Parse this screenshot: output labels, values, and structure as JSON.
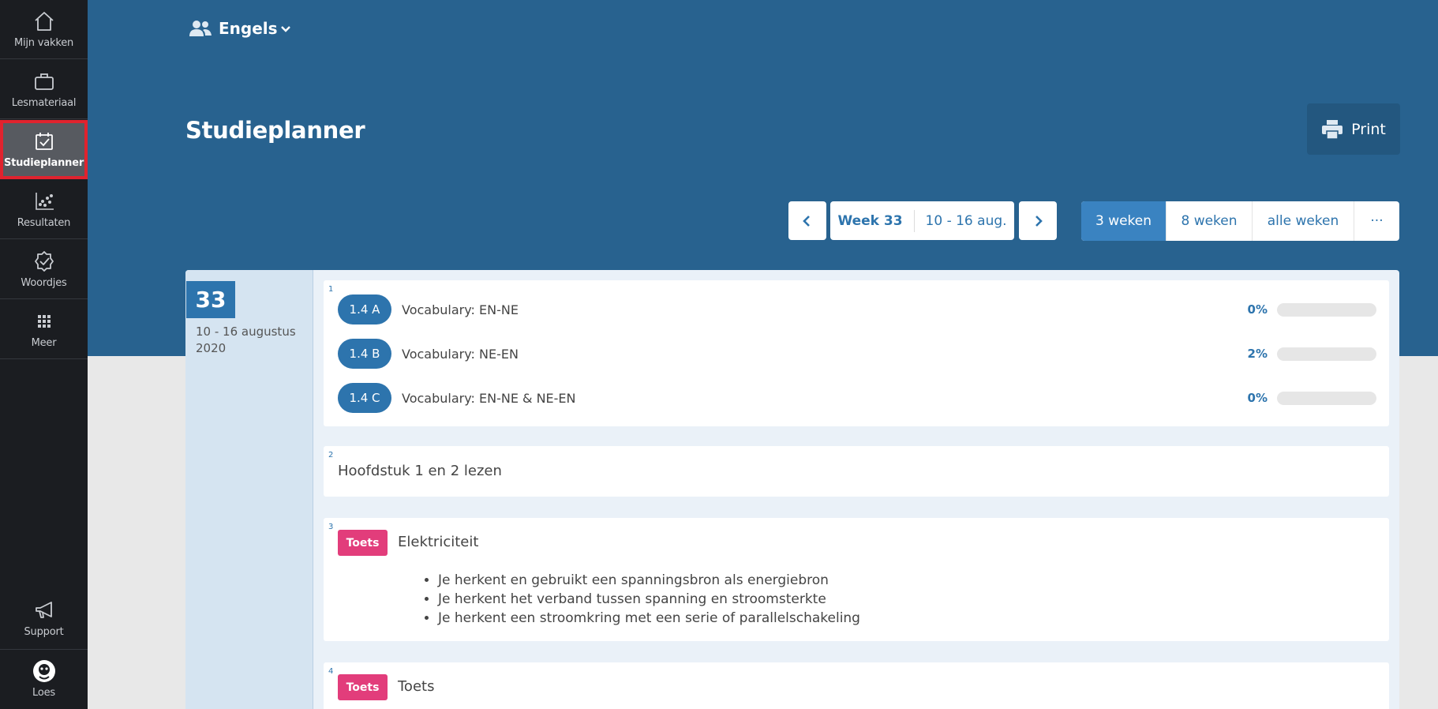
{
  "sidebar": {
    "items": [
      {
        "label": "Mijn vakken",
        "icon": "home-icon"
      },
      {
        "label": "Lesmateriaal",
        "icon": "briefcase-icon"
      },
      {
        "label": "Studieplanner",
        "icon": "calendar-check-icon",
        "active": true
      },
      {
        "label": "Resultaten",
        "icon": "chart-icon"
      },
      {
        "label": "Woordjes",
        "icon": "badge-check-icon"
      },
      {
        "label": "Meer",
        "icon": "grid-icon"
      }
    ],
    "support": {
      "label": "Support",
      "icon": "megaphone-icon"
    },
    "user": {
      "label": "Loes",
      "icon": "avatar-icon"
    }
  },
  "header": {
    "course": "Engels",
    "title": "Studieplanner",
    "print_label": "Print"
  },
  "week_nav": {
    "week": "Week 33",
    "range": "10 - 16 aug."
  },
  "range_options": [
    "3 weken",
    "8 weken",
    "alle weken",
    "···"
  ],
  "planner": {
    "week_number": "33",
    "week_dates": "10 - 16 augustus 2020",
    "cards": [
      {
        "num": "1",
        "rows": [
          {
            "code": "1.4 A",
            "title": "Vocabulary: EN-NE",
            "progress_label": "0%",
            "progress": 0
          },
          {
            "code": "1.4 B",
            "title": "Vocabulary: NE-EN",
            "progress_label": "2%",
            "progress": 2
          },
          {
            "code": "1.4 C",
            "title": "Vocabulary: EN-NE & NE-EN",
            "progress_label": "0%",
            "progress": 0
          }
        ]
      },
      {
        "num": "2",
        "text": "Hoofdstuk 1 en 2 lezen"
      },
      {
        "num": "3",
        "tag": "Toets",
        "title": "Elektriciteit",
        "bullets": [
          "Je herkent en gebruikt een spanningsbron als energiebron",
          "Je herkent het verband tussen spanning en stroomsterkte",
          "Je herkent een stroomkring met een serie of parallelschakeling"
        ]
      },
      {
        "num": "4",
        "tag": "Toets",
        "title": "Toets"
      }
    ]
  },
  "colors": {
    "sidebar_bg": "#1b1d21",
    "header_bg": "#28628f",
    "accent": "#2d74ad",
    "tag": "#e23d7b",
    "active_outline": "#e0232e"
  }
}
